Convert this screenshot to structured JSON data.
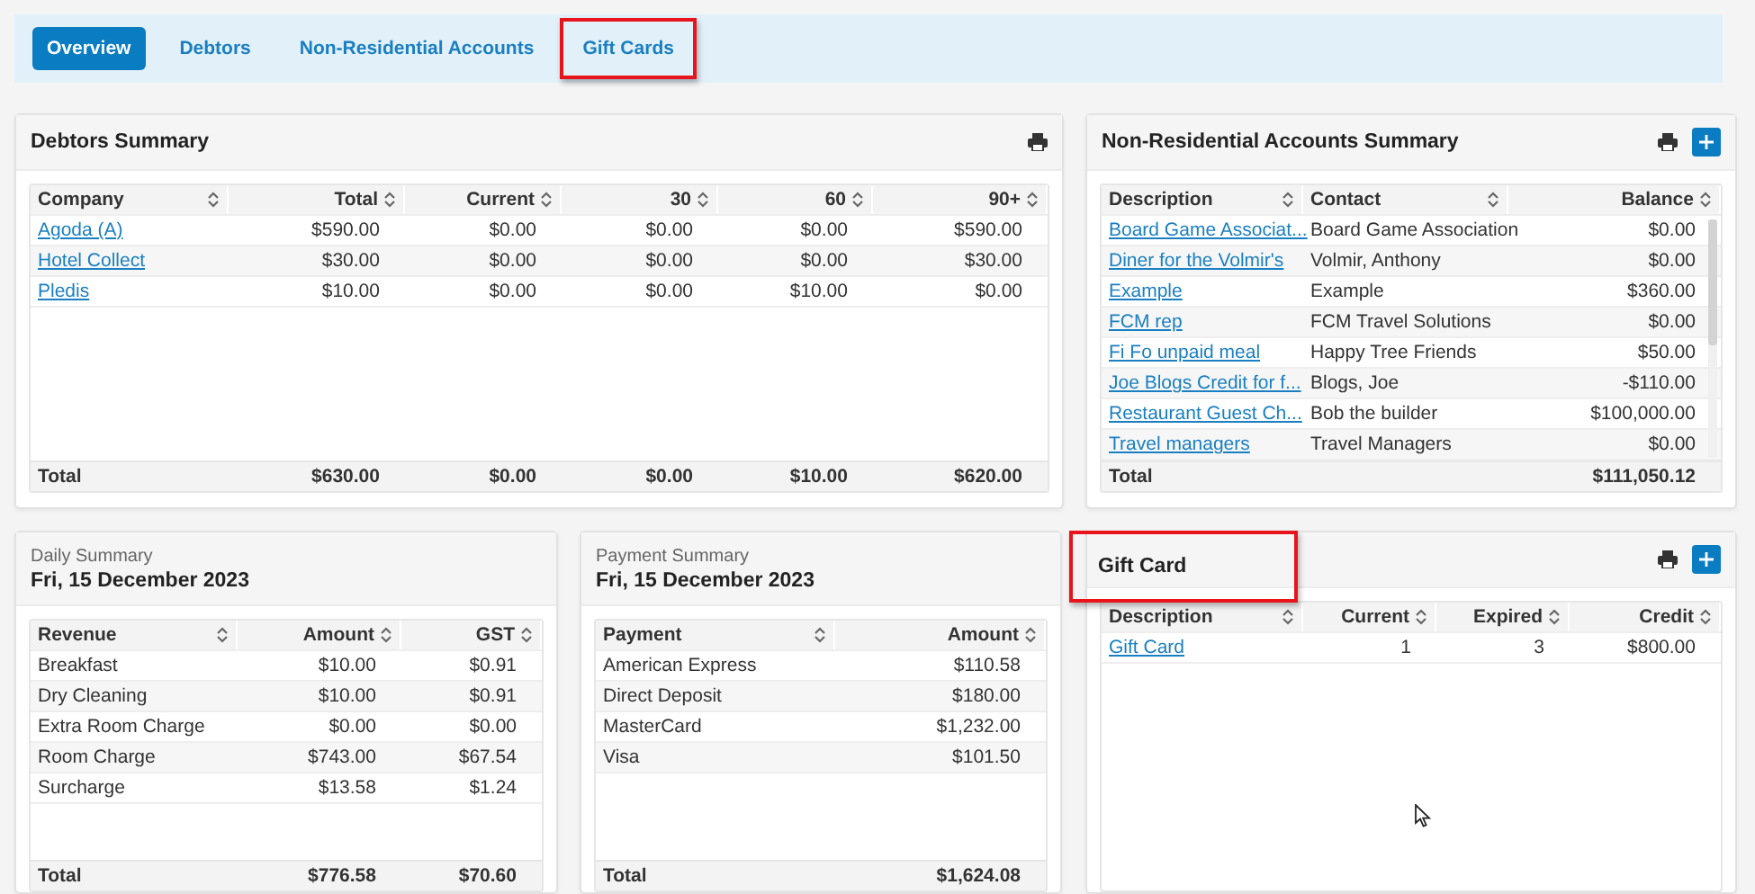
{
  "tabs": [
    {
      "label": "Overview",
      "selected": true,
      "highlighted": false
    },
    {
      "label": "Debtors",
      "selected": false,
      "highlighted": false
    },
    {
      "label": "Non-Residential Accounts",
      "selected": false,
      "highlighted": false
    },
    {
      "label": "Gift Cards",
      "selected": false,
      "highlighted": true
    }
  ],
  "debtors_summary": {
    "title": "Debtors Summary",
    "table": {
      "columns": [
        {
          "label": "Company",
          "kind": "link"
        },
        {
          "label": "Total",
          "kind": "number"
        },
        {
          "label": "Current",
          "kind": "number"
        },
        {
          "label": "30",
          "kind": "number"
        },
        {
          "label": "60",
          "kind": "number"
        },
        {
          "label": "90+",
          "kind": "number"
        }
      ],
      "rows": [
        [
          "Agoda (A)",
          "$590.00",
          "$0.00",
          "$0.00",
          "$0.00",
          "$590.00"
        ],
        [
          "Hotel Collect",
          "$30.00",
          "$0.00",
          "$0.00",
          "$0.00",
          "$30.00"
        ],
        [
          "Pledis",
          "$10.00",
          "$0.00",
          "$0.00",
          "$10.00",
          "$0.00"
        ]
      ],
      "total": [
        "Total",
        "$630.00",
        "$0.00",
        "$0.00",
        "$10.00",
        "$620.00"
      ]
    }
  },
  "non_residential_summary": {
    "title": "Non-Residential Accounts Summary",
    "table": {
      "columns": [
        {
          "label": "Description",
          "kind": "link"
        },
        {
          "label": "Contact",
          "kind": "text"
        },
        {
          "label": "Balance",
          "kind": "number"
        }
      ],
      "rows": [
        [
          "Board Game Associat...",
          "Board Game Association",
          "$0.00"
        ],
        [
          "Diner for the Volmir's",
          "Volmir, Anthony",
          "$0.00"
        ],
        [
          "Example",
          "Example",
          "$360.00"
        ],
        [
          "FCM rep",
          "FCM Travel Solutions",
          "$0.00"
        ],
        [
          "Fi Fo unpaid meal",
          "Happy Tree Friends",
          "$50.00"
        ],
        [
          "Joe Blogs Credit for f...",
          "Blogs, Joe",
          "-$110.00"
        ],
        [
          "Restaurant Guest Ch...",
          "Bob the builder",
          "$100,000.00"
        ],
        [
          "Travel managers",
          "Travel Managers",
          "$0.00"
        ]
      ],
      "total": [
        "Total",
        "$111,050.12"
      ]
    }
  },
  "daily_summary": {
    "subtitle": "Daily Summary",
    "date": "Fri, 15 December 2023",
    "table": {
      "columns": [
        {
          "label": "Revenue",
          "kind": "text"
        },
        {
          "label": "Amount",
          "kind": "number"
        },
        {
          "label": "GST",
          "kind": "number"
        }
      ],
      "rows": [
        [
          "Breakfast",
          "$10.00",
          "$0.91"
        ],
        [
          "Dry Cleaning",
          "$10.00",
          "$0.91"
        ],
        [
          "Extra Room Charge",
          "$0.00",
          "$0.00"
        ],
        [
          "Room Charge",
          "$743.00",
          "$67.54"
        ],
        [
          "Surcharge",
          "$13.58",
          "$1.24"
        ]
      ],
      "total": [
        "Total",
        "$776.58",
        "$70.60"
      ]
    }
  },
  "payment_summary": {
    "subtitle": "Payment Summary",
    "date": "Fri, 15 December 2023",
    "table": {
      "columns": [
        {
          "label": "Payment",
          "kind": "text"
        },
        {
          "label": "Amount",
          "kind": "number"
        }
      ],
      "rows": [
        [
          "American Express",
          "$110.58"
        ],
        [
          "Direct Deposit",
          "$180.00"
        ],
        [
          "MasterCard",
          "$1,232.00"
        ],
        [
          "Visa",
          "$101.50"
        ]
      ],
      "total": [
        "Total",
        "$1,624.08"
      ]
    }
  },
  "gift_card": {
    "title": "Gift Card",
    "highlighted": true,
    "table": {
      "columns": [
        {
          "label": "Description",
          "kind": "link"
        },
        {
          "label": "Current",
          "kind": "number"
        },
        {
          "label": "Expired",
          "kind": "number"
        },
        {
          "label": "Credit",
          "kind": "number"
        }
      ],
      "rows": [
        [
          "Gift Card",
          "1",
          "3",
          "$800.00"
        ]
      ]
    }
  }
}
